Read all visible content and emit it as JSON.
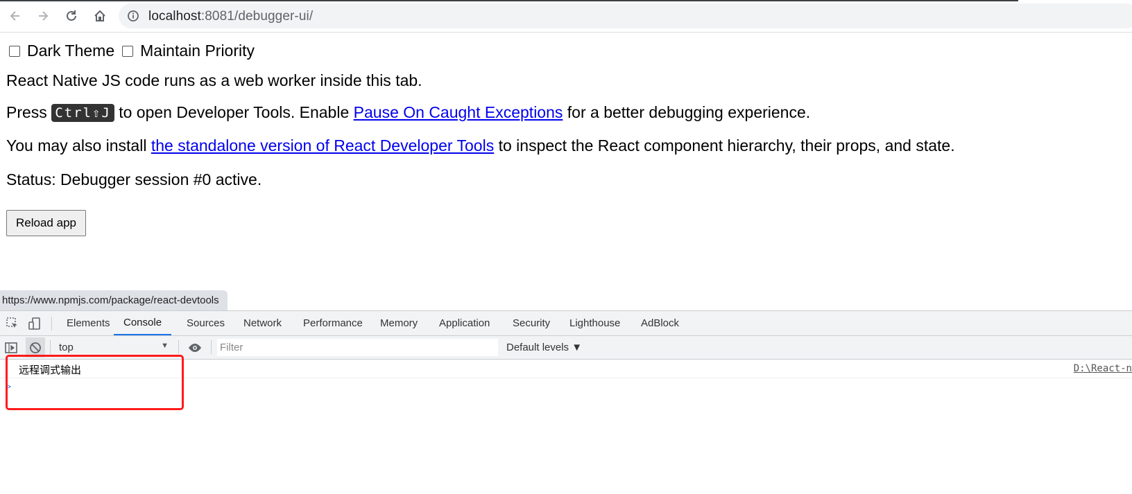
{
  "browser": {
    "url_host": "localhost",
    "url_rest": ":8081/debugger-ui/"
  },
  "page": {
    "dark_theme_label": "Dark Theme",
    "maintain_priority_label": "Maintain Priority",
    "line1": "React Native JS code runs as a web worker inside this tab.",
    "line2_prefix": "Press ",
    "line2_kbd": "Ctrl⇧J",
    "line2_mid": " to open Developer Tools. Enable ",
    "line2_link": "Pause On Caught Exceptions",
    "line2_suffix": " for a better debugging experience.",
    "line3_prefix": "You may also install ",
    "line3_link": "the standalone version of React Developer Tools",
    "line3_suffix": " to inspect the React component hierarchy, their props, and state.",
    "status": "Status: Debugger session #0 active.",
    "reload_label": "Reload app"
  },
  "status_link": "https://www.npmjs.com/package/react-devtools",
  "devtools": {
    "tabs": [
      "Elements",
      "Console",
      "Sources",
      "Network",
      "Performance",
      "Memory",
      "Application",
      "Security",
      "Lighthouse",
      "AdBlock"
    ],
    "active_tab": "Console",
    "context": "top",
    "filter_placeholder": "Filter",
    "levels_label": "Default levels ▼",
    "message": "远程调式输出",
    "message_source": "D:\\React-n",
    "prompt": ">"
  },
  "colors": {
    "link": "#0000ee",
    "active_tab_underline": "#1a73e8",
    "highlight_box": "#ff1a1a"
  }
}
